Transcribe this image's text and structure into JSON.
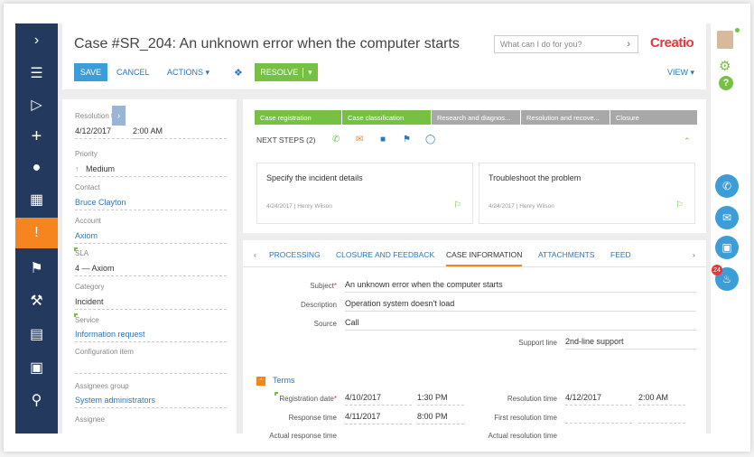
{
  "header": {
    "title": "Case #SR_204: An unknown error when the computer starts",
    "search_placeholder": "What can I do for you?",
    "logo": "Creatio"
  },
  "toolbar": {
    "save": "SAVE",
    "cancel": "CANCEL",
    "actions": "ACTIONS",
    "resolve": "RESOLVE",
    "view": "VIEW"
  },
  "sidebar": {
    "items": [
      "expand",
      "menu",
      "play",
      "add",
      "contacts",
      "accounts",
      "cases",
      "flag",
      "tools",
      "documents",
      "dashboards",
      "search"
    ]
  },
  "left_fields": [
    {
      "label": "Resolution time",
      "value": "4/12/2017",
      "value2": "2:00 AM"
    },
    {
      "label": "Priority",
      "value": "Medium"
    },
    {
      "label": "Contact",
      "value": "Bruce Clayton"
    },
    {
      "label": "Account",
      "value": "Axiom"
    },
    {
      "label": "SLA",
      "value": "4 — Axiom"
    },
    {
      "label": "Category",
      "value": "Incident"
    },
    {
      "label": "Service",
      "value": "Information request"
    },
    {
      "label": "Configuration item",
      "value": ""
    },
    {
      "label": "Assignees group",
      "value": "System administrators"
    },
    {
      "label": "Assignee",
      "value": ""
    }
  ],
  "stages": [
    {
      "label": "Case registration",
      "state": "done"
    },
    {
      "label": "Case classification",
      "state": "done"
    },
    {
      "label": "Research and diagnos...",
      "state": "todo"
    },
    {
      "label": "Resolution and recove...",
      "state": "todo"
    },
    {
      "label": "Closure",
      "state": "todo"
    }
  ],
  "next_steps": {
    "label": "NEXT STEPS (2)",
    "tasks": [
      {
        "title": "Specify the incident details",
        "meta": "4/24/2017 | Henry Wilson"
      },
      {
        "title": "Troubleshoot the problem",
        "meta": "4/24/2017 | Henry Wilson"
      }
    ]
  },
  "tabs": [
    "PROCESSING",
    "CLOSURE AND FEEDBACK",
    "CASE INFORMATION",
    "ATTACHMENTS",
    "FEED"
  ],
  "case_info": {
    "subject_label": "Subject",
    "subject": "An unknown error when the computer starts",
    "description_label": "Description",
    "description": "Operation system doesn't load",
    "source_label": "Source",
    "source": "Call",
    "support_line_label": "Support line",
    "support_line": "2nd-line support",
    "terms_label": "Terms",
    "registration_date_label": "Registration date",
    "registration_date": "4/10/2017",
    "registration_time": "1:30 PM",
    "resolution_time_label": "Resolution time",
    "resolution_date": "4/12/2017",
    "resolution_time": "2:00 AM",
    "response_time_label": "Response time",
    "response_date": "4/11/2017",
    "response_time": "8:00 PM",
    "first_resolution_label": "First resolution time",
    "actual_response_label": "Actual response time",
    "actual_resolution_label": "Actual resolution time"
  },
  "notifications": {
    "count": "24"
  },
  "colors": {
    "sidebar": "#23395d",
    "accent": "#f6851f",
    "primary": "#3d9dd9",
    "success": "#76c043",
    "brand": "#e5383b"
  }
}
